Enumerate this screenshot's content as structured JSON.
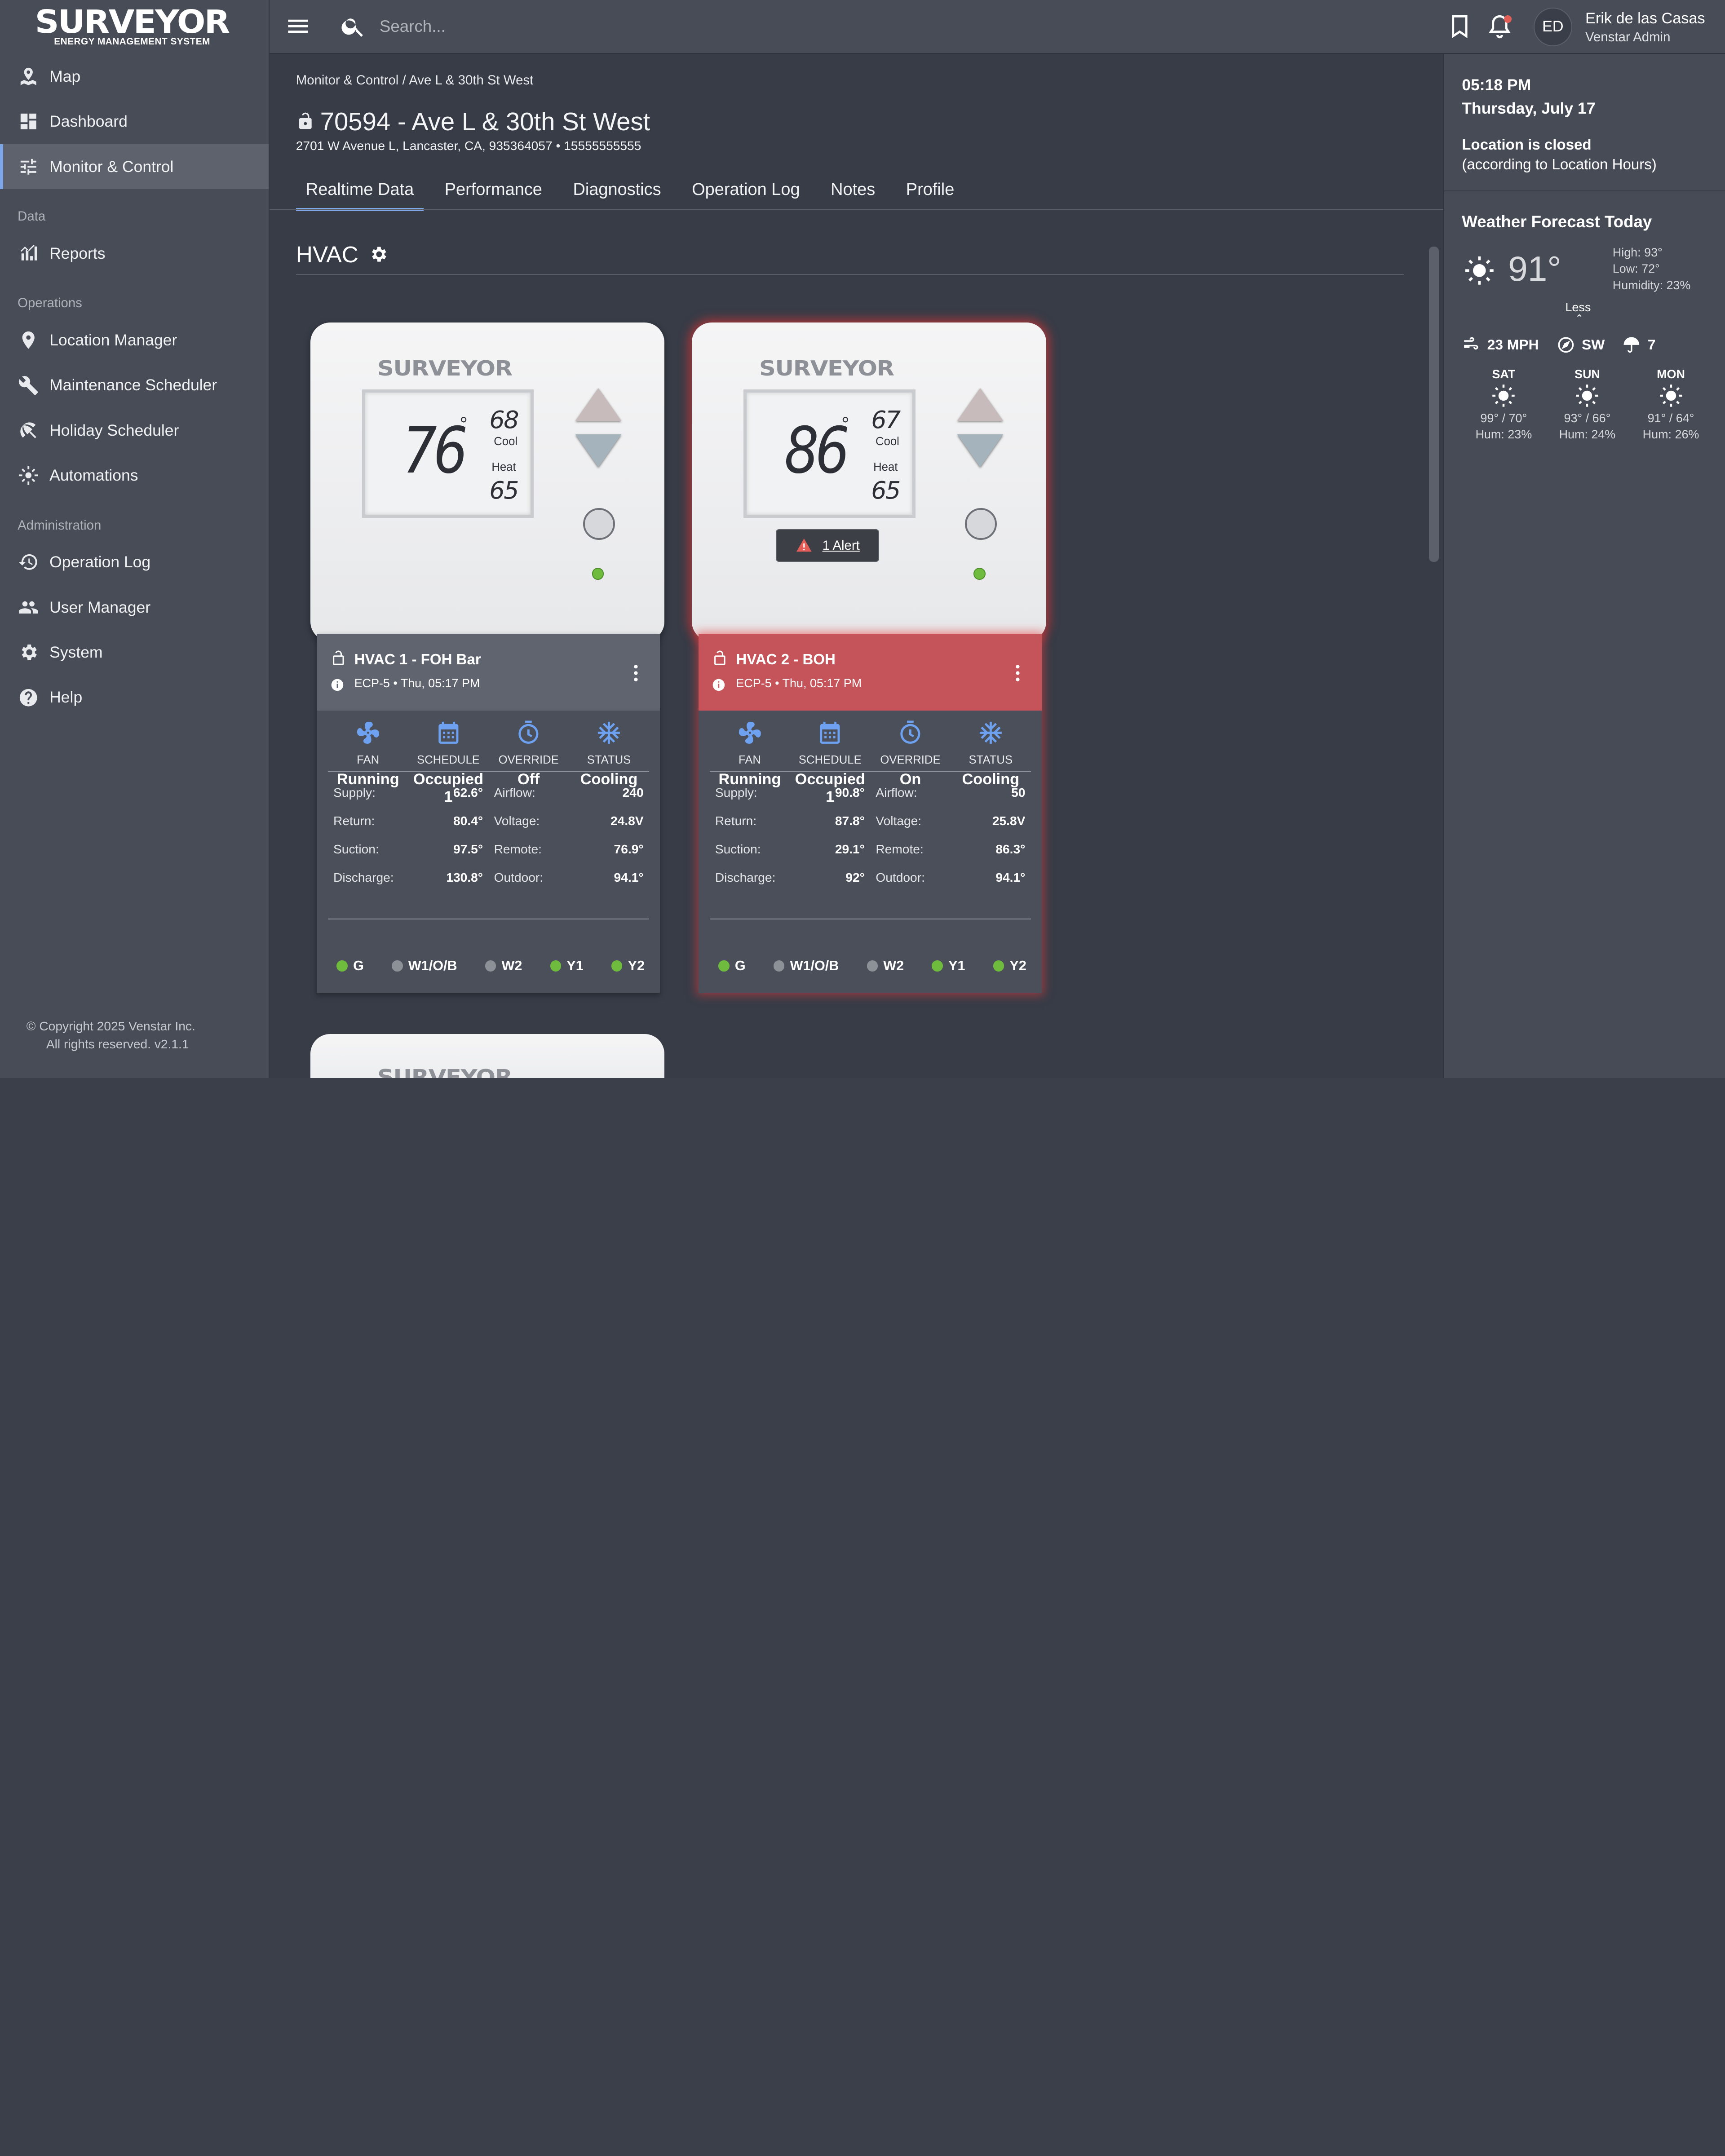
{
  "app": {
    "logo_main": "SURVEYOR",
    "logo_sub": "ENERGY MANAGEMENT SYSTEM"
  },
  "sidebar": {
    "items_top": [
      {
        "label": "Map",
        "icon": "map-icon"
      },
      {
        "label": "Dashboard",
        "icon": "dashboard-icon"
      },
      {
        "label": "Monitor & Control",
        "icon": "sliders-icon",
        "active": true
      }
    ],
    "section_data": "Data",
    "items_data": [
      {
        "label": "Reports",
        "icon": "chart-icon"
      }
    ],
    "section_ops": "Operations",
    "items_ops": [
      {
        "label": "Location Manager",
        "icon": "pin-icon"
      },
      {
        "label": "Maintenance Scheduler",
        "icon": "wrench-icon"
      },
      {
        "label": "Holiday Scheduler",
        "icon": "umbrella-icon"
      },
      {
        "label": "Automations",
        "icon": "gear-icon"
      }
    ],
    "section_admin": "Administration",
    "items_admin": [
      {
        "label": "Operation Log",
        "icon": "history-icon"
      },
      {
        "label": "User Manager",
        "icon": "users-icon"
      },
      {
        "label": "System",
        "icon": "gear-icon"
      },
      {
        "label": "Help",
        "icon": "help-icon"
      }
    ],
    "copyright_line1": "©  Copyright 2025 Venstar Inc.",
    "copyright_line2": "All rights reserved. v2.1.1"
  },
  "topbar": {
    "search_placeholder": "Search...",
    "avatar_initials": "ED",
    "user_name": "Erik de las Casas",
    "user_role": "Venstar Admin"
  },
  "main": {
    "breadcrumb": [
      "Monitor & Control",
      "Ave L & 30th St West"
    ],
    "breadcrumb_sep": "/",
    "title": "70594 - Ave L & 30th St West",
    "address": "2701 W Avenue L, Lancaster, CA, 935364057  •  15555555555",
    "tabs": [
      "Realtime Data",
      "Performance",
      "Diagnostics",
      "Operation Log",
      "Notes",
      "Profile"
    ],
    "active_tab": "Realtime Data",
    "section_title": "HVAC"
  },
  "units": [
    {
      "brand": "SURVEYOR",
      "temp": "76",
      "deg": "°",
      "cool_set": "68",
      "heat_set": "65",
      "cool_label": "Cool",
      "heat_label": "Heat",
      "name": "HVAC 1 - FOH Bar",
      "sub": "ECP-5 • Thu, 05:17 PM",
      "alert": "",
      "status": [
        {
          "label": "FAN",
          "value": "Running",
          "icon": "fan-icon"
        },
        {
          "label": "SCHEDULE",
          "value": "Occupied 1",
          "icon": "calendar-icon"
        },
        {
          "label": "OVERRIDE",
          "value": "Off",
          "icon": "timer-icon"
        },
        {
          "label": "STATUS",
          "value": "Cooling",
          "icon": "snowflake-icon"
        }
      ],
      "metrics": [
        [
          "Supply:",
          "62.6°",
          "Airflow:",
          "240"
        ],
        [
          "Return:",
          "80.4°",
          "Voltage:",
          "24.8V"
        ],
        [
          "Suction:",
          "97.5°",
          "Remote:",
          "76.9°"
        ],
        [
          "Discharge:",
          "130.8°",
          "Outdoor:",
          "94.1°"
        ]
      ],
      "relays": [
        {
          "label": "G",
          "on": true
        },
        {
          "label": "W1/O/B",
          "on": false
        },
        {
          "label": "W2",
          "on": false
        },
        {
          "label": "Y1",
          "on": true
        },
        {
          "label": "Y2",
          "on": true
        }
      ]
    },
    {
      "brand": "SURVEYOR",
      "temp": "86",
      "deg": "°",
      "cool_set": "67",
      "heat_set": "65",
      "cool_label": "Cool",
      "heat_label": "Heat",
      "name": "HVAC 2 - BOH",
      "sub": "ECP-5 • Thu, 05:17 PM",
      "alert": "1 Alert",
      "status": [
        {
          "label": "FAN",
          "value": "Running",
          "icon": "fan-icon"
        },
        {
          "label": "SCHEDULE",
          "value": "Occupied 1",
          "icon": "calendar-icon"
        },
        {
          "label": "OVERRIDE",
          "value": "On",
          "icon": "timer-icon"
        },
        {
          "label": "STATUS",
          "value": "Cooling",
          "icon": "snowflake-icon"
        }
      ],
      "metrics": [
        [
          "Supply:",
          "90.8°",
          "Airflow:",
          "50"
        ],
        [
          "Return:",
          "87.8°",
          "Voltage:",
          "25.8V"
        ],
        [
          "Suction:",
          "29.1°",
          "Remote:",
          "86.3°"
        ],
        [
          "Discharge:",
          "92°",
          "Outdoor:",
          "94.1°"
        ]
      ],
      "relays": [
        {
          "label": "G",
          "on": true
        },
        {
          "label": "W1/O/B",
          "on": false
        },
        {
          "label": "W2",
          "on": false
        },
        {
          "label": "Y1",
          "on": true
        },
        {
          "label": "Y2",
          "on": true
        }
      ]
    }
  ],
  "third_device_brand": "SURVEYOR",
  "right": {
    "time": "05:18 PM",
    "date": "Thursday, July 17",
    "closed_title": "Location is closed",
    "closed_sub": "(according to Location Hours)",
    "weather_title": "Weather Forecast Today",
    "current_temp": "91°",
    "high": "High: 93°",
    "low": "Low: 72°",
    "humidity": "Humidity: 23%",
    "less_label": "Less",
    "wind_speed": "23 MPH",
    "wind_dir": "SW",
    "precip": "7",
    "forecast": [
      {
        "day": "SAT",
        "temps": "99° / 70°",
        "hum": "Hum: 23%"
      },
      {
        "day": "SUN",
        "temps": "93° / 66°",
        "hum": "Hum: 24%"
      },
      {
        "day": "MON",
        "temps": "91° / 64°",
        "hum": "Hum: 26%"
      }
    ]
  },
  "colors": {
    "accent": "#7da7e8",
    "alert": "#c5545a",
    "led_on": "#6fbb3e"
  }
}
